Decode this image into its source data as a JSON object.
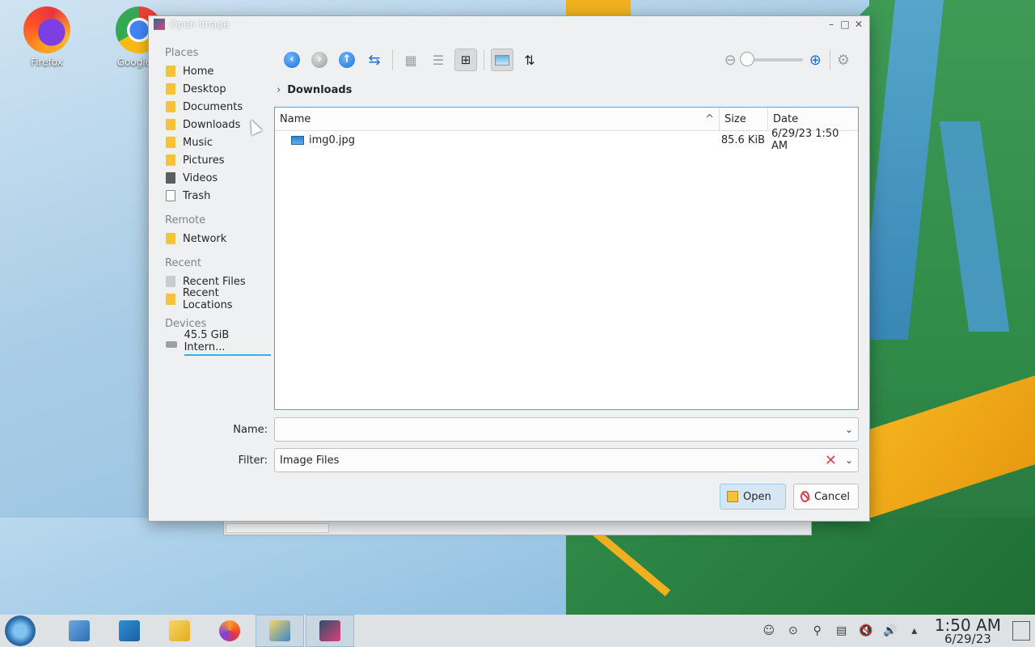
{
  "desktop": {
    "icons": [
      {
        "label": "Firefox"
      },
      {
        "label": "Google C"
      }
    ]
  },
  "dialog": {
    "title": "Open Image",
    "places": {
      "sections": [
        {
          "title": "Places",
          "items": [
            "Home",
            "Desktop",
            "Documents",
            "Downloads",
            "Music",
            "Pictures",
            "Videos",
            "Trash"
          ]
        },
        {
          "title": "Remote",
          "items": [
            "Network"
          ]
        },
        {
          "title": "Recent",
          "items": [
            "Recent Files",
            "Recent Locations"
          ]
        },
        {
          "title": "Devices",
          "items": [
            "45.5 GiB Intern..."
          ]
        }
      ]
    },
    "breadcrumb": {
      "current": "Downloads"
    },
    "filelist": {
      "columns": [
        "Name",
        "Size",
        "Date"
      ],
      "rows": [
        {
          "name": "img0.jpg",
          "size": "85.6 KiB",
          "date": "6/29/23 1:50 AM"
        }
      ]
    },
    "name_field": {
      "label": "Name:",
      "value": ""
    },
    "filter_field": {
      "label": "Filter:",
      "value": "Image Files"
    },
    "buttons": {
      "open": "Open",
      "cancel": "Cancel"
    },
    "zoom_level": 0
  },
  "taskbar": {
    "clock_time": "1:50 AM",
    "clock_date": "6/29/23"
  },
  "colors": {
    "accent": "#3daee9",
    "folder": "#f6c338",
    "danger": "#da4453"
  }
}
